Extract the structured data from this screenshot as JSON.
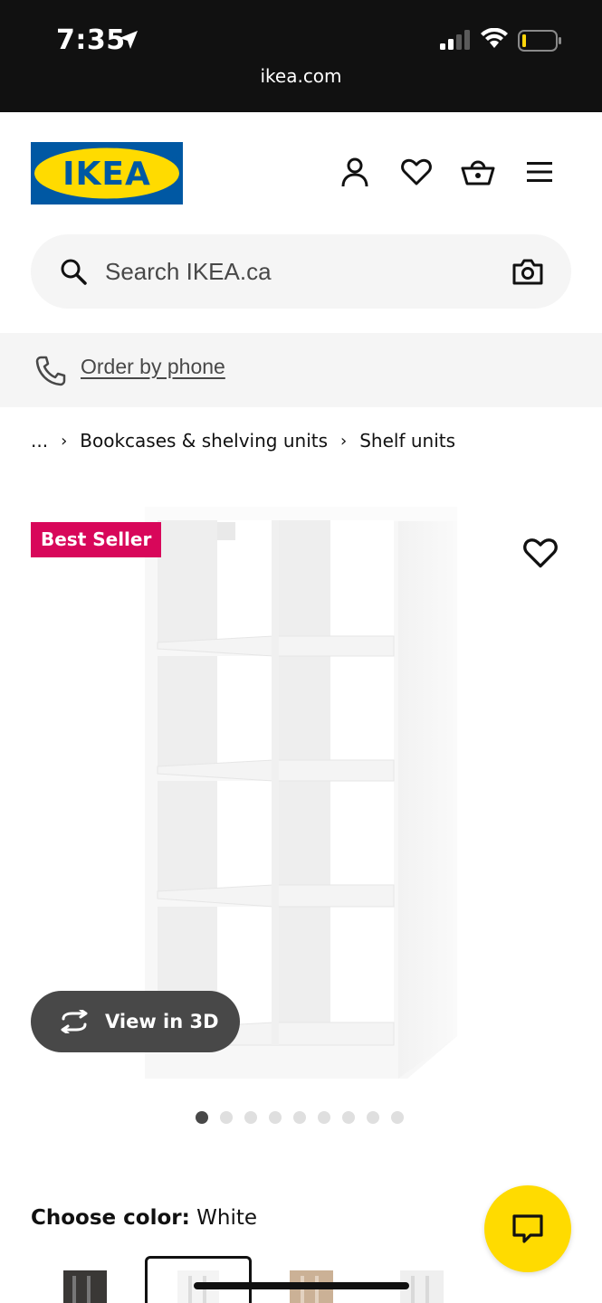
{
  "status_bar": {
    "time": "7:35",
    "url": "ikea.com",
    "icons": [
      "location-arrow-icon",
      "signal-icon",
      "wifi-icon",
      "battery-icon"
    ]
  },
  "header": {
    "logo_text": "IKEA",
    "icons": [
      "account-icon",
      "heart-icon",
      "basket-icon",
      "menu-icon"
    ],
    "brand_colors": {
      "blue": "#0058a3",
      "yellow": "#ffdb00"
    }
  },
  "search": {
    "placeholder": "Search IKEA.ca",
    "value": ""
  },
  "phone_strip": {
    "link_label": "Order by phone"
  },
  "breadcrumb": {
    "items": [
      "...",
      "Bookcases & shelving units",
      "Shelf units"
    ]
  },
  "product": {
    "badge": "Best Seller",
    "badge_color": "#d8075a",
    "view3d_label": "View in 3D",
    "image_count": 9,
    "active_image": 1
  },
  "color_chooser": {
    "label": "Choose color:",
    "selected": "White"
  },
  "chat": {
    "icon": "chat-icon",
    "color": "#ffdb00"
  }
}
